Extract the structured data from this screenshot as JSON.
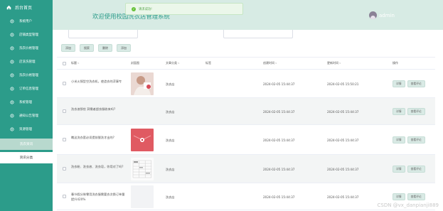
{
  "sidebar": {
    "home_label": "后台首页",
    "items": [
      {
        "label": "系统用户"
      },
      {
        "label": "店铺类型管理"
      },
      {
        "label": "洗衣价格管理"
      },
      {
        "label": "店洗洗管理"
      },
      {
        "label": "洗衣价格管理"
      },
      {
        "label": "订单信息管理"
      },
      {
        "label": "系统管理"
      },
      {
        "label": "通知公告管理"
      },
      {
        "label": "资源管理"
      }
    ],
    "sub_items": [
      {
        "label": "洗衣资讯",
        "active": true
      },
      {
        "label": "资讯分类",
        "active": false
      }
    ],
    "bg_color": "#2c9c8a"
  },
  "header": {
    "title": "欢迎使用校园洗衣店管理系统",
    "user": "admin",
    "bg_color": "#d7ebe4"
  },
  "toast": {
    "message": "请求成功!",
    "icon": "check-circle-icon"
  },
  "toolbar": {
    "buttons": [
      {
        "label": "添加"
      },
      {
        "label": "搜索"
      },
      {
        "label": "删除"
      },
      {
        "label": "添加"
      }
    ]
  },
  "table": {
    "columns": [
      "标题",
      "封面图",
      "文章分类",
      "标签",
      "创建时间",
      "更新时间",
      "操作"
    ],
    "rows": [
      {
        "title": "小米火锅型空洗衣机，使造衣的浮事专",
        "cover": "photo",
        "category": "洗衣店",
        "tag": "",
        "created": "2024-02-05 15:44:37",
        "updated": "2024-02-05 15:50:21",
        "actions": [
          "详情",
          "查看评论"
        ]
      },
      {
        "title": "洗衣液那些 洞需者超衣服收来吗?",
        "cover": "",
        "category": "洗衣店",
        "tag": "",
        "created": "2024-02-05 15:44:37",
        "updated": "2024-02-05 15:44:37",
        "actions": [
          "详情",
          "查看评论"
        ]
      },
      {
        "title": "瞧这洗衣套必须提前脱洗才出的?",
        "cover": "red",
        "category": "洗衣店",
        "tag": "",
        "created": "2024-02-05 15:44:37",
        "updated": "2024-02-05 15:44:37",
        "actions": [
          "详情",
          "查看评论"
        ]
      },
      {
        "title": "洗衣粉、洗衣液、洗衣皂，你用对了吗?",
        "cover": "table",
        "category": "洗衣店",
        "tag": "",
        "created": "2024-02-05 15:44:37",
        "updated": "2024-02-05 15:44:37",
        "actions": [
          "详情",
          "查看评论"
        ]
      },
      {
        "title": "春节假分装零用洗衣服需要衣次换订单量提升420%",
        "cover": "light",
        "category": "洗衣店",
        "tag": "",
        "created": "2024-02-05 15:44:37",
        "updated": "2024-02-05 15:44:37",
        "actions": [
          "详情",
          "查看评论"
        ]
      }
    ]
  },
  "watermark": "CSDN @vx_danpianji889"
}
